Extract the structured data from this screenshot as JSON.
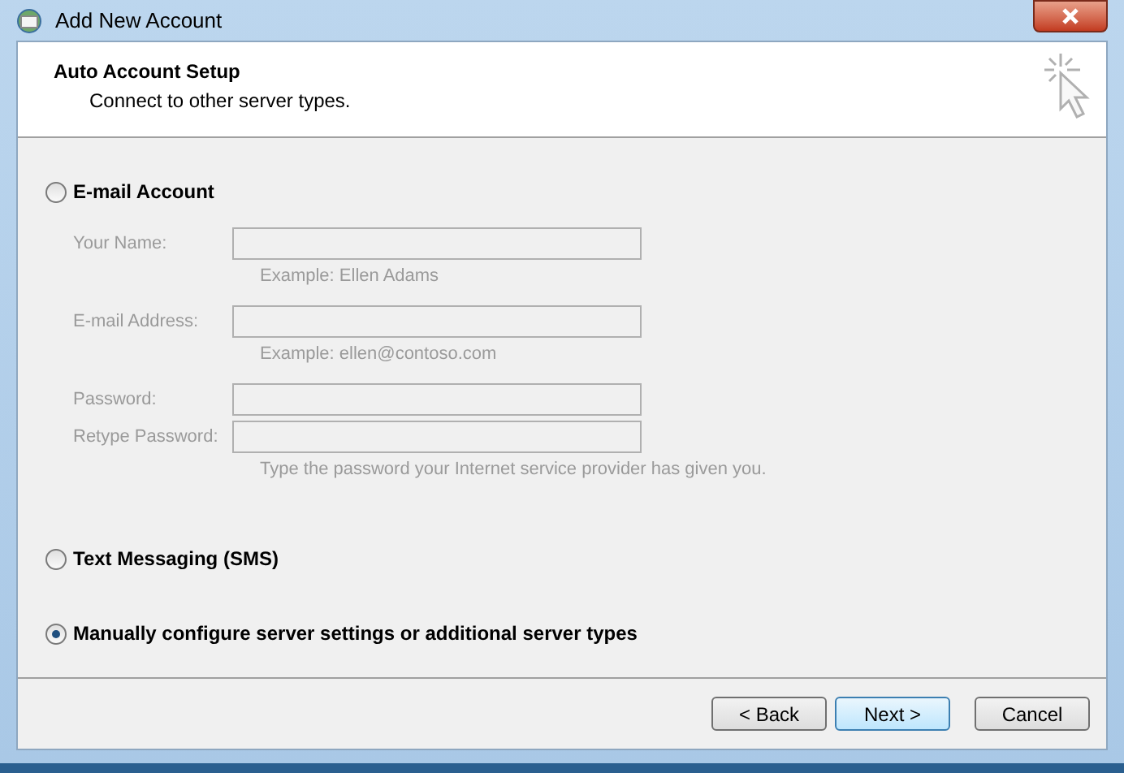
{
  "window": {
    "title": "Add New Account"
  },
  "header": {
    "title": "Auto Account Setup",
    "subtitle": "Connect to other server types."
  },
  "options": [
    {
      "label": "E-mail Account",
      "selected": false,
      "fields": [
        {
          "label": "Your Name:",
          "disabled": true,
          "hint": "Example: Ellen Adams"
        },
        {
          "label": "E-mail Address:",
          "disabled": true,
          "hint": "Example: ellen@contoso.com"
        },
        {
          "label": "Password:",
          "disabled": true
        },
        {
          "label": "Retype Password:",
          "disabled": true,
          "hint": "Type the password your Internet service provider has given you."
        }
      ]
    },
    {
      "label": "Text Messaging (SMS)",
      "selected": false
    },
    {
      "label": "Manually configure server settings or additional server types",
      "selected": true
    }
  ],
  "buttons": [
    {
      "label": "< Back",
      "default": false
    },
    {
      "label": "Next >",
      "default": true
    },
    {
      "label": "Cancel",
      "default": false
    }
  ]
}
